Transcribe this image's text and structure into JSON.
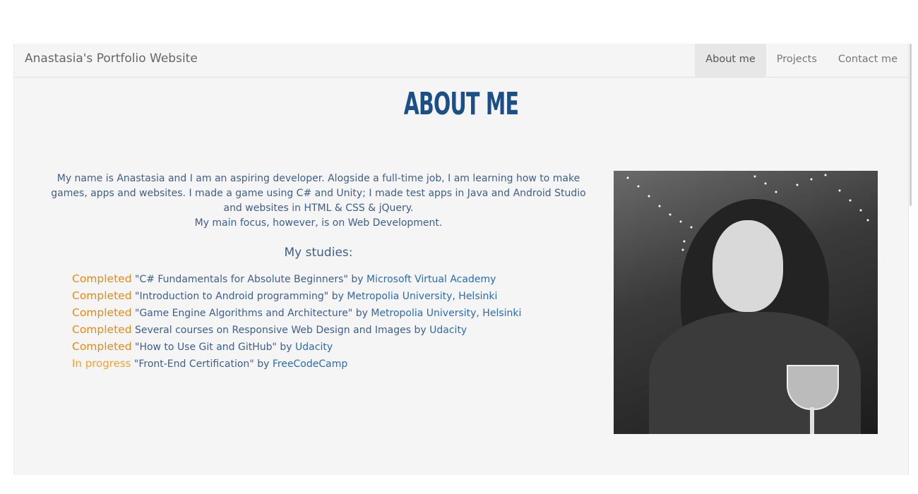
{
  "navbar": {
    "brand": "Anastasia's Portfolio Website",
    "tabs": [
      {
        "label": "About me",
        "active": true
      },
      {
        "label": "Projects",
        "active": false
      },
      {
        "label": "Contact me",
        "active": false
      }
    ]
  },
  "main": {
    "title": "ABOUT ME",
    "bio": {
      "line1": "My name is Anastasia and I am an aspiring developer. Alogside a full-time job, I am learning how to make games, apps and websites. I made a game using C# and Unity; I made test apps in Java and Android Studio and websites in HTML & CSS & jQuery.",
      "line2": "My main focus, however, is on Web Development."
    },
    "studies_heading": "My studies:",
    "studies": [
      {
        "status": "Completed",
        "course": "\"C# Fundamentals for Absolute Beginners\" by ",
        "provider": "Microsoft Virtual Academy"
      },
      {
        "status": "Completed",
        "course": "\"Introduction to Android programming\" by ",
        "provider": "Metropolia University, Helsinki"
      },
      {
        "status": "Completed",
        "course": "\"Game Engine Algorithms and Architecture\" by ",
        "provider": "Metropolia University, Helsinki"
      },
      {
        "status": "Completed",
        "course": "Several courses on Responsive Web Design and Images by ",
        "provider": "Udacity"
      },
      {
        "status": "Completed",
        "course": "\"How to Use Git and GitHub\" by ",
        "provider": "Udacity"
      },
      {
        "status": "In progress",
        "course": "\"Front-End Certification\" by ",
        "provider": "FreeCodeCamp"
      }
    ]
  },
  "colors": {
    "title": "#1a4f87",
    "text": "#3d5f8a",
    "completed": "#e68a1a",
    "in_progress": "#f2a03a",
    "link": "#2b6cb0",
    "background": "#f5f5f5"
  }
}
